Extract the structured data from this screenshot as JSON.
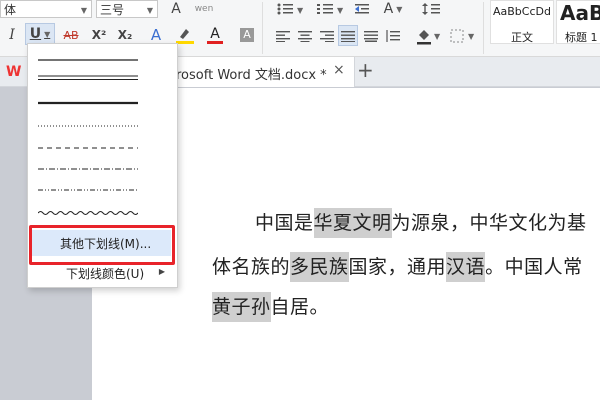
{
  "ribbon": {
    "font_name": "体",
    "font_size": "三号",
    "text_effect_label": "A",
    "phonetic_label": "wen",
    "grow_font_label": "A",
    "shrink_font_label": "A",
    "italic_label": "I",
    "underline_label": "U",
    "strike_label": "AB",
    "superscript_label": "X²",
    "subscript_label": "X₂",
    "font_color_label": "A",
    "char_shading_label": "A",
    "styles": [
      {
        "sample": "AaBbCcDd",
        "name": "正文"
      },
      {
        "sample": "AaB",
        "name": "标题 1"
      }
    ]
  },
  "tabs": {
    "doc_title": "rosoft Word 文档.docx *",
    "close": "×",
    "add": "+"
  },
  "underline_menu": {
    "styles": [
      "single",
      "double",
      "thick",
      "dotted",
      "dashed",
      "dash-dot",
      "dash-dot-dot",
      "wave"
    ],
    "more_label": "其他下划线(M)...",
    "color_label": "下划线颜色(U)"
  },
  "document": {
    "line1": [
      {
        "text": "中国是",
        "hl": false
      },
      {
        "text": "华夏文明",
        "hl": true
      },
      {
        "text": "为源泉，中华文化为基",
        "hl": false
      }
    ],
    "line2": [
      {
        "text": "体名族的",
        "hl": false
      },
      {
        "text": "多民族",
        "hl": true
      },
      {
        "text": "国家，通用",
        "hl": false
      },
      {
        "text": "汉语",
        "hl": true
      },
      {
        "text": "。中国人常",
        "hl": false
      }
    ],
    "line3": [
      {
        "text": "黄子孙",
        "hl": true
      },
      {
        "text": "自居。",
        "hl": false
      }
    ]
  },
  "colors": {
    "highlight": "#cfcfcf",
    "annotation_box": "#e8232a",
    "menu_hover": "#dce9fa",
    "font_color_bar": "#e02020",
    "highlight_bar": "#ffd800"
  }
}
